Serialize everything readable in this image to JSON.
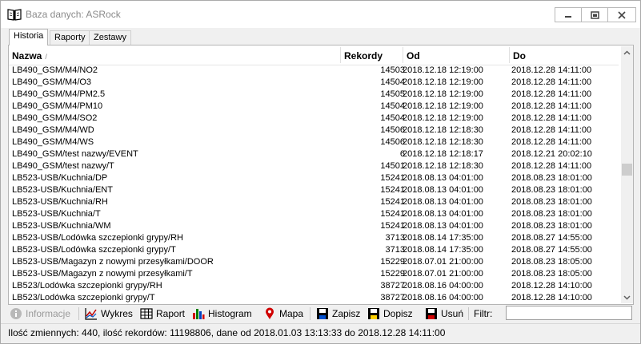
{
  "window": {
    "title": "Baza danych: ASRock"
  },
  "tabs": [
    {
      "label": "Historia"
    },
    {
      "label": "Raporty"
    },
    {
      "label": "Zestawy"
    }
  ],
  "table": {
    "columns": [
      "Nazwa",
      "Rekordy",
      "Od",
      "Do"
    ],
    "sort_indicator": "/",
    "rows": [
      [
        "LB490_GSM/M4/NO2",
        "14503",
        "2018.12.18 12:19:00",
        "2018.12.28 14:11:00"
      ],
      [
        "LB490_GSM/M4/O3",
        "14504",
        "2018.12.18 12:19:00",
        "2018.12.28 14:11:00"
      ],
      [
        "LB490_GSM/M4/PM2.5",
        "14505",
        "2018.12.18 12:19:00",
        "2018.12.28 14:11:00"
      ],
      [
        "LB490_GSM/M4/PM10",
        "14504",
        "2018.12.18 12:19:00",
        "2018.12.28 14:11:00"
      ],
      [
        "LB490_GSM/M4/SO2",
        "14504",
        "2018.12.18 12:19:00",
        "2018.12.28 14:11:00"
      ],
      [
        "LB490_GSM/M4/WD",
        "14506",
        "2018.12.18 12:18:30",
        "2018.12.28 14:11:00"
      ],
      [
        "LB490_GSM/M4/WS",
        "14506",
        "2018.12.18 12:18:30",
        "2018.12.28 14:11:00"
      ],
      [
        "LB490_GSM/test nazwy/EVENT",
        "6",
        "2018.12.18 12:18:17",
        "2018.12.21 20:02:10"
      ],
      [
        "LB490_GSM/test nazwy/T",
        "14501",
        "2018.12.18 12:18:30",
        "2018.12.28 14:11:00"
      ],
      [
        "LB523-USB/Kuchnia/DP",
        "15241",
        "2018.08.13 04:01:00",
        "2018.08.23 18:01:00"
      ],
      [
        "LB523-USB/Kuchnia/ENT",
        "15241",
        "2018.08.13 04:01:00",
        "2018.08.23 18:01:00"
      ],
      [
        "LB523-USB/Kuchnia/RH",
        "15241",
        "2018.08.13 04:01:00",
        "2018.08.23 18:01:00"
      ],
      [
        "LB523-USB/Kuchnia/T",
        "15241",
        "2018.08.13 04:01:00",
        "2018.08.23 18:01:00"
      ],
      [
        "LB523-USB/Kuchnia/WM",
        "15241",
        "2018.08.13 04:01:00",
        "2018.08.23 18:01:00"
      ],
      [
        "LB523-USB/Lodówka szczepionki grypy/RH",
        "3713",
        "2018.08.14 17:35:00",
        "2018.08.27 14:55:00"
      ],
      [
        "LB523-USB/Lodówka szczepionki grypy/T",
        "3713",
        "2018.08.14 17:35:00",
        "2018.08.27 14:55:00"
      ],
      [
        "LB523-USB/Magazyn z nowymi przesyłkami/DOOR",
        "15229",
        "2018.07.01 21:00:00",
        "2018.08.23 18:05:00"
      ],
      [
        "LB523-USB/Magazyn z nowymi przesyłkami/T",
        "15229",
        "2018.07.01 21:00:00",
        "2018.08.23 18:05:00"
      ],
      [
        "LB523/Lodówka szczepionki grypy/RH",
        "38727",
        "2018.08.16 04:00:00",
        "2018.12.28 14:10:00"
      ],
      [
        "LB523/Lodówka szczepionki grypy/T",
        "38727",
        "2018.08.16 04:00:00",
        "2018.12.28 14:10:00"
      ]
    ]
  },
  "toolbar": {
    "info": "Informacje",
    "chart": "Wykres",
    "report": "Raport",
    "histogram": "Histogram",
    "map": "Mapa",
    "save": "Zapisz",
    "append": "Dopisz",
    "delete": "Usuń",
    "filter_label": "Filtr:",
    "filter_value": ""
  },
  "status": {
    "text": "Ilość zmiennych: 440, ilość rekordów: 11198806, dane od 2018.01.03 13:13:33 do 2018.12.28 14:11:00"
  }
}
